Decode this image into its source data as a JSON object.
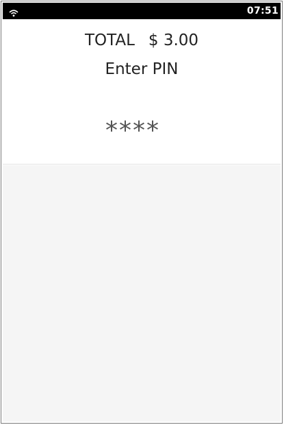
{
  "status_bar": {
    "icon": "wifi-icon",
    "time": "07:51"
  },
  "payment": {
    "total_label": "TOTAL",
    "total_amount": "$ 3.00",
    "prompt": "Enter PIN",
    "pin_mask": "****"
  },
  "colors": {
    "status_bar_bg": "#000000",
    "lower_area_bg": "#f5f5f5"
  }
}
